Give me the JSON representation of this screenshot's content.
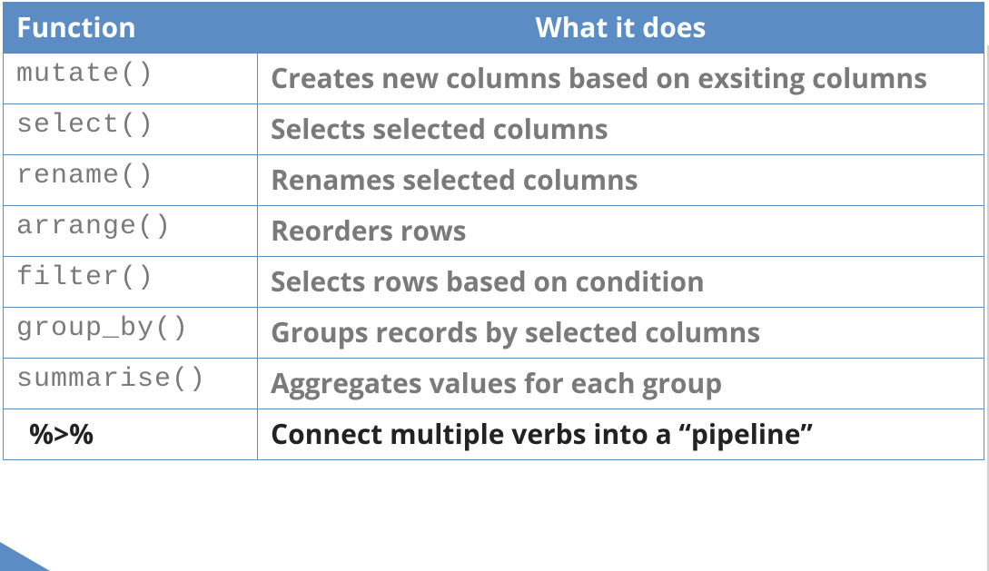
{
  "table": {
    "headers": {
      "function": "Function",
      "description": "What it does"
    },
    "rows": [
      {
        "func": "mutate()",
        "desc": "Creates new columns based on exsiting columns",
        "pipe": false
      },
      {
        "func": "select()",
        "desc": "Selects selected columns",
        "pipe": false
      },
      {
        "func": "rename()",
        "desc": "Renames selected columns",
        "pipe": false
      },
      {
        "func": "arrange()",
        "desc": "Reorders rows",
        "pipe": false
      },
      {
        "func": "filter()",
        "desc": "Selects rows based on condition",
        "pipe": false
      },
      {
        "func": "group_by()",
        "desc": "Groups records by selected columns",
        "pipe": false
      },
      {
        "func": "summarise()",
        "desc": "Aggregates values for each group",
        "pipe": false
      },
      {
        "func": "%>%",
        "desc": "Connect multiple verbs into a “pipeline”",
        "pipe": true
      }
    ]
  }
}
